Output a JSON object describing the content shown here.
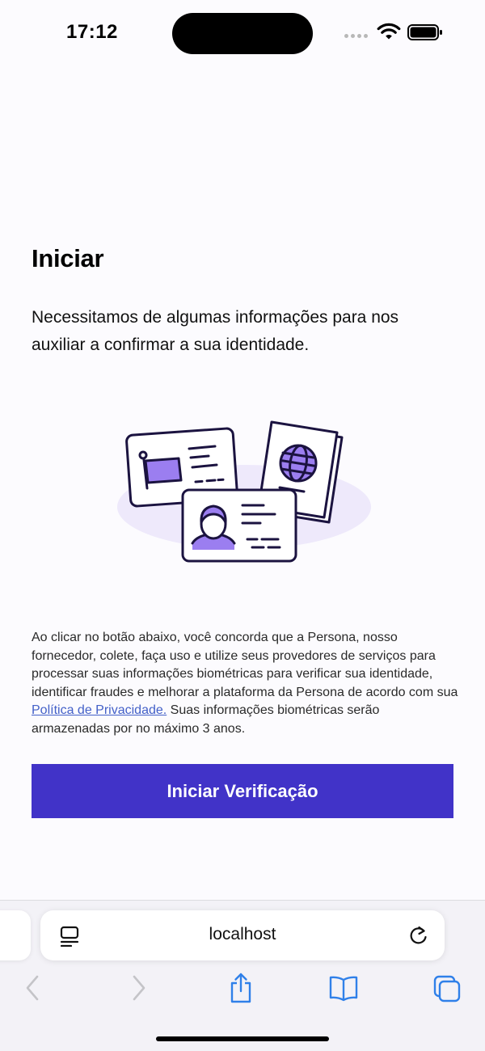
{
  "status_bar": {
    "time": "17:12",
    "icons": [
      "signal-icon",
      "wifi-icon",
      "battery-icon"
    ]
  },
  "content": {
    "title": "Iniciar",
    "intro": "Necessitamos de algumas informações para nos auxiliar a confirmar a sua identidade.",
    "illustration": "id-documents-illustration",
    "consent_before_link": "Ao clicar no botão abaixo, você concorda que a Persona, nosso fornecedor, colete, faça uso e utilize seus provedores de serviços para processar suas informações biométricas para verificar sua identidade, identificar fraudes e melhorar a plataforma da Persona de acordo com sua ",
    "consent_link": "Política de Privacidade.",
    "consent_after_link": " Suas informações biométricas serão armazenadas por no máximo 3 anos.",
    "start_button_label": "Iniciar Verificação"
  },
  "browser": {
    "url": "localhost",
    "toolbar_icons": [
      "back-icon",
      "forward-icon",
      "share-icon",
      "bookmarks-icon",
      "tabs-icon"
    ]
  },
  "colors": {
    "accent": "#4133c8",
    "illustration_purple": "#9b7ef0",
    "illustration_backdrop": "#eee9fb",
    "illustration_outline": "#1b1340",
    "link": "#4360c8",
    "ios_blue": "#2f80e9",
    "background": "#fcfbfe"
  }
}
